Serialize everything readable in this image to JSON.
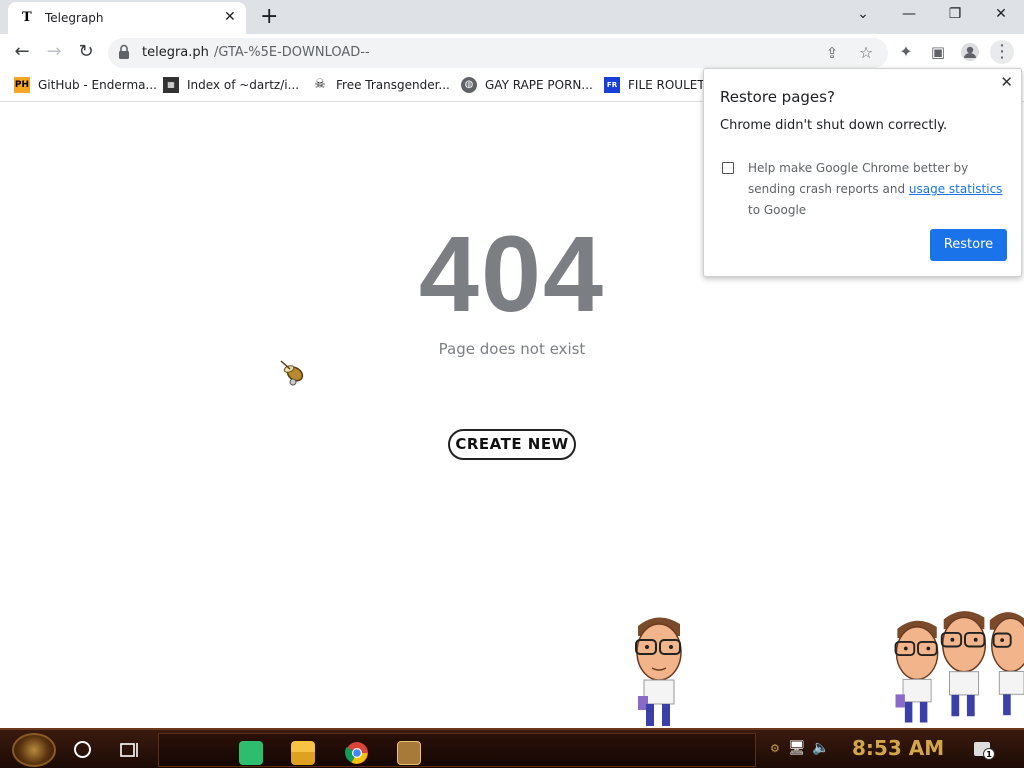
{
  "browser": {
    "tab": {
      "favicon": "T",
      "title": "Telegraph"
    },
    "new_tab_label": "+",
    "window_controls": [
      "minimize-icon",
      "maximize-icon",
      "close-icon"
    ],
    "address": {
      "host": "telegra.ph",
      "path": "/GTA-%5E-DOWNLOAD--"
    },
    "bookmarks": [
      {
        "icon": "PH",
        "label": "GitHub - Enderma..."
      },
      {
        "icon": "grid",
        "label": "Index of ~dartz/i..."
      },
      {
        "icon": "skull",
        "label": "Free Transgender..."
      },
      {
        "icon": "globe",
        "label": "GAY RAPE PORN..."
      },
      {
        "icon": "FR",
        "label": "FILE ROULET"
      }
    ]
  },
  "page": {
    "code": "404",
    "message": "Page does not exist",
    "create_button": "CREATE NEW"
  },
  "popup": {
    "title": "Restore pages?",
    "message": "Chrome didn't shut down correctly.",
    "consent_before": "Help make Google Chrome better by sending crash reports and ",
    "consent_link": "usage statistics",
    "consent_after": " to Google",
    "restore_button": "Restore"
  },
  "taskbar": {
    "pinned": [
      "notes-app-icon",
      "file-explorer-icon",
      "chrome-icon",
      "game-app-icon"
    ],
    "clock": "8:53 AM",
    "notification_count": "1"
  },
  "colors": {
    "accent": "#1a73e8",
    "muted_text": "#7b7f84",
    "taskbar_clock": "#d4a64a"
  }
}
